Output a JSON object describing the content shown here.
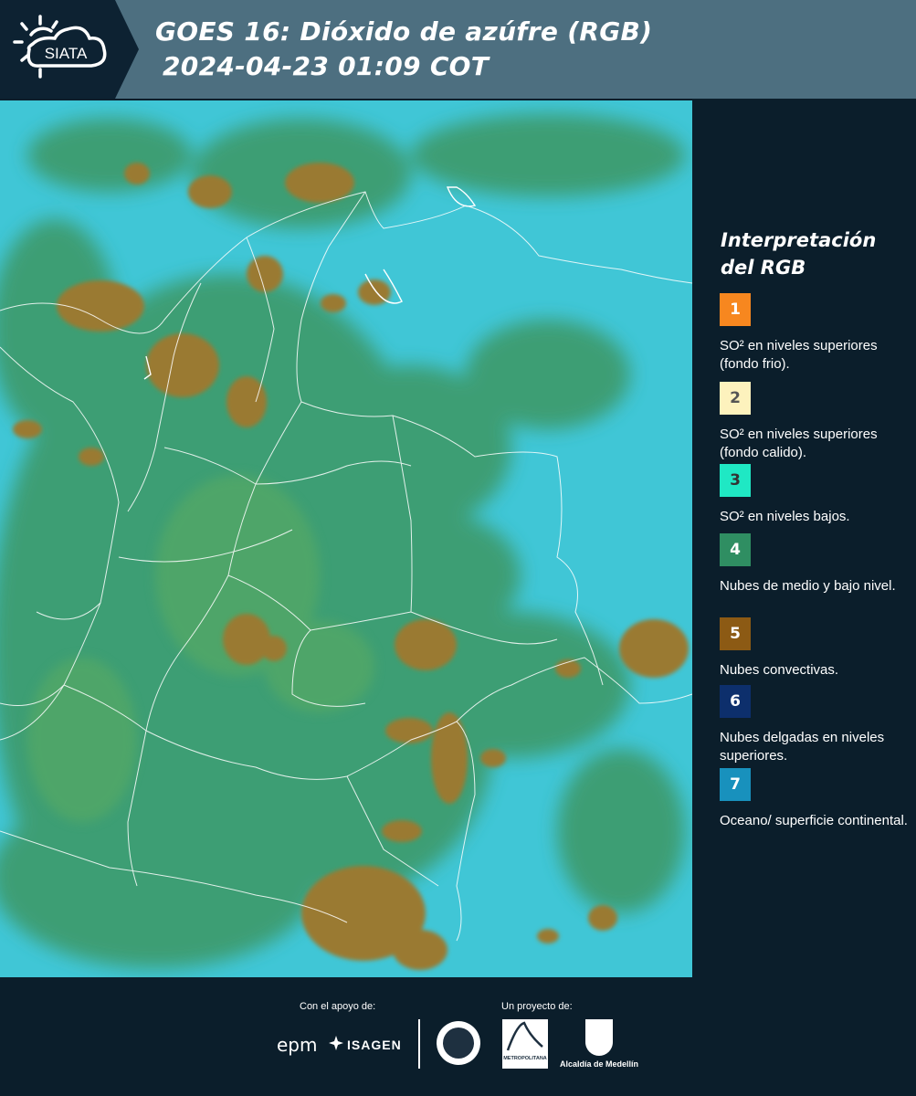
{
  "header": {
    "logo_text": "SIATA",
    "title_line1": "GOES 16: Dióxido de azúfre (RGB)",
    "title_line2": "2024-04-23 01:09 COT"
  },
  "legend": {
    "title": "Interpretación del RGB",
    "items": [
      {
        "number": "1",
        "color": "#f7871f",
        "number_color": "#ffffff",
        "text": "SO² en niveles superiores (fondo frio)."
      },
      {
        "number": "2",
        "color": "#fdf2bd",
        "number_color": "#555555",
        "text": "SO² en niveles superiores (fondo calido)."
      },
      {
        "number": "3",
        "color": "#1fe8c4",
        "number_color": "#333333",
        "text": "SO² en niveles bajos."
      },
      {
        "number": "4",
        "color": "#2f8e62",
        "number_color": "#ffffff",
        "text": "Nubes de medio y bajo nivel."
      },
      {
        "number": "5",
        "color": "#8c5a14",
        "number_color": "#ffffff",
        "text": "Nubes convectivas."
      },
      {
        "number": "6",
        "color": "#0d2f6c",
        "number_color": "#ffffff",
        "text": "Nubes delgadas en niveles superiores."
      },
      {
        "number": "7",
        "color": "#1891bd",
        "number_color": "#ffffff",
        "text": "Oceano/ superficie continental."
      }
    ]
  },
  "footer": {
    "support_label": "Con el apoyo de:",
    "project_label": "Un proyecto de:",
    "sponsor_epm": "epm",
    "sponsor_isagen": "ISAGEN",
    "amva_label": "METROPOLITANA",
    "medellin_label": "Alcaldía de Medellín"
  }
}
